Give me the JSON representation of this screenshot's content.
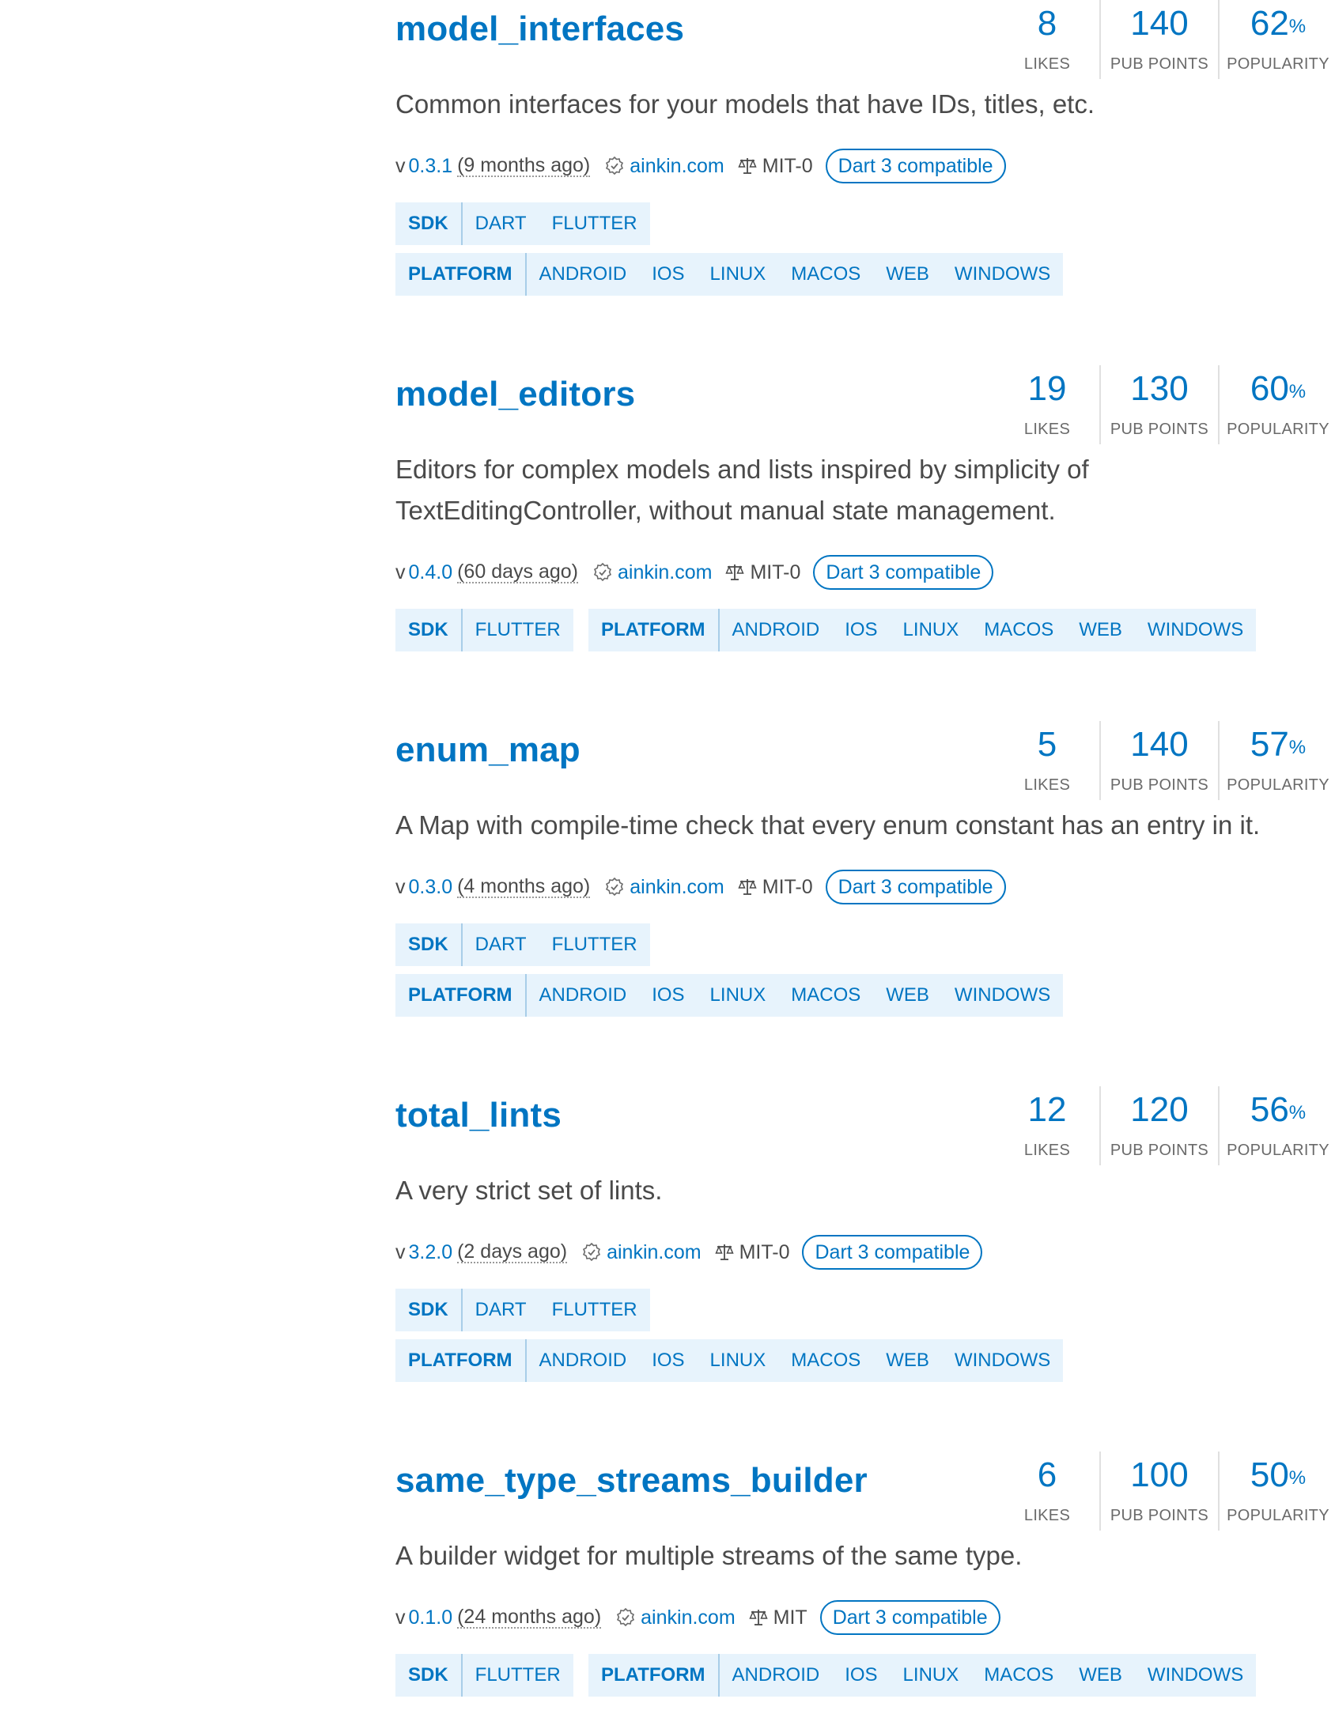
{
  "metric_labels": {
    "likes": "LIKES",
    "points": "PUB POINTS",
    "popularity": "POPULARITY"
  },
  "colors": {
    "accent": "#0175c2",
    "tag_bg": "#e7f3fc",
    "text": "#4a4a4a"
  },
  "packages": [
    {
      "name": "model_interfaces",
      "likes": "8",
      "points": "140",
      "popularity": "62",
      "percent_sign": "%",
      "description": "Common interfaces for your models that have IDs, titles, etc.",
      "version_prefix": "v",
      "version": "0.3.1",
      "published": "(9 months ago)",
      "publisher": "ainkin.com",
      "license": "MIT-0",
      "badge": "Dart 3 compatible",
      "sdk_label": "SDK",
      "sdk": [
        "DART",
        "FLUTTER"
      ],
      "platform_label": "PLATFORM",
      "platforms": [
        "ANDROID",
        "IOS",
        "LINUX",
        "MACOS",
        "WEB",
        "WINDOWS"
      ]
    },
    {
      "name": "model_editors",
      "likes": "19",
      "points": "130",
      "popularity": "60",
      "percent_sign": "%",
      "description": "Editors for complex models and lists inspired by simplicity of TextEditingController, without manual state management.",
      "version_prefix": "v",
      "version": "0.4.0",
      "published": "(60 days ago)",
      "publisher": "ainkin.com",
      "license": "MIT-0",
      "badge": "Dart 3 compatible",
      "sdk_label": "SDK",
      "sdk": [
        "FLUTTER"
      ],
      "platform_label": "PLATFORM",
      "platforms": [
        "ANDROID",
        "IOS",
        "LINUX",
        "MACOS",
        "WEB",
        "WINDOWS"
      ]
    },
    {
      "name": "enum_map",
      "likes": "5",
      "points": "140",
      "popularity": "57",
      "percent_sign": "%",
      "description": "A Map with compile-time check that every enum constant has an entry in it.",
      "version_prefix": "v",
      "version": "0.3.0",
      "published": "(4 months ago)",
      "publisher": "ainkin.com",
      "license": "MIT-0",
      "badge": "Dart 3 compatible",
      "sdk_label": "SDK",
      "sdk": [
        "DART",
        "FLUTTER"
      ],
      "platform_label": "PLATFORM",
      "platforms": [
        "ANDROID",
        "IOS",
        "LINUX",
        "MACOS",
        "WEB",
        "WINDOWS"
      ]
    },
    {
      "name": "total_lints",
      "likes": "12",
      "points": "120",
      "popularity": "56",
      "percent_sign": "%",
      "description": "A very strict set of lints.",
      "version_prefix": "v",
      "version": "3.2.0",
      "published": "(2 days ago)",
      "publisher": "ainkin.com",
      "license": "MIT-0",
      "badge": "Dart 3 compatible",
      "sdk_label": "SDK",
      "sdk": [
        "DART",
        "FLUTTER"
      ],
      "platform_label": "PLATFORM",
      "platforms": [
        "ANDROID",
        "IOS",
        "LINUX",
        "MACOS",
        "WEB",
        "WINDOWS"
      ]
    },
    {
      "name": "same_type_streams_builder",
      "likes": "6",
      "points": "100",
      "popularity": "50",
      "percent_sign": "%",
      "description": "A builder widget for multiple streams of the same type.",
      "version_prefix": "v",
      "version": "0.1.0",
      "published": "(24 months ago)",
      "publisher": "ainkin.com",
      "license": "MIT",
      "badge": "Dart 3 compatible",
      "sdk_label": "SDK",
      "sdk": [
        "FLUTTER"
      ],
      "platform_label": "PLATFORM",
      "platforms": [
        "ANDROID",
        "IOS",
        "LINUX",
        "MACOS",
        "WEB",
        "WINDOWS"
      ]
    }
  ]
}
